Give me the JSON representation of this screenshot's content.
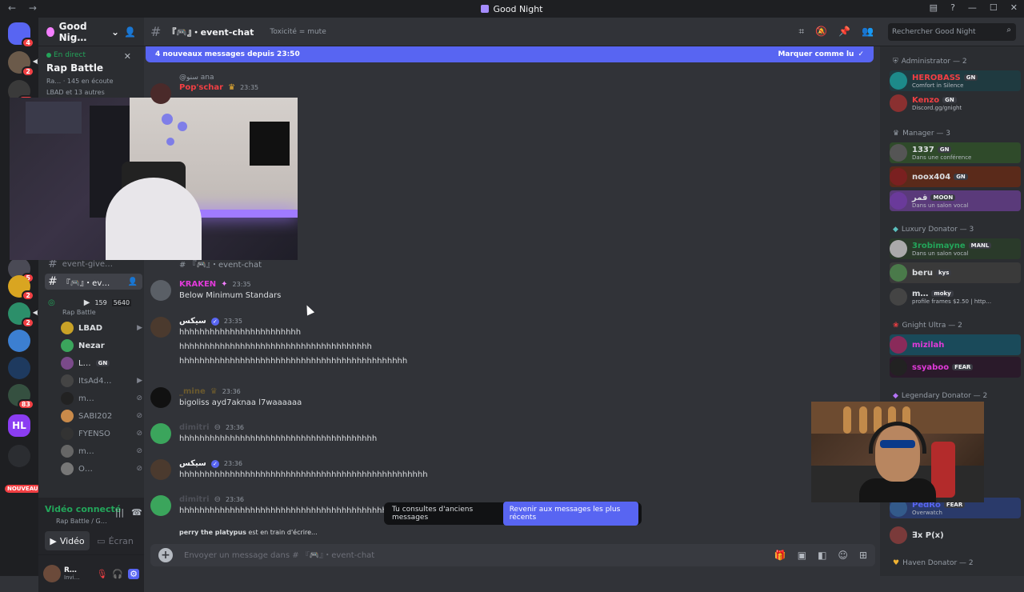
{
  "titlebar": {
    "title": "Good Night",
    "nav_arrows": "← →"
  },
  "server": {
    "name": "Good Nig…",
    "live_label": "En direct",
    "live_channel": "Rap Battle",
    "live_meta": "Ra… · 145 en écoute",
    "live_meta2": "LBAD et 13 autres"
  },
  "guild_badges": [
    "4",
    "2",
    "21",
    "5",
    "2",
    "2",
    "83"
  ],
  "guild_new": "NOUVEAU",
  "sidebar_channels": {
    "giveaway": "event-give…",
    "active": "『🎮』・ev…",
    "voice_name": "Rap Battle",
    "voice_counts": [
      "159",
      "5640"
    ]
  },
  "voice_users": [
    {
      "name": "LBAD",
      "color": "#dbdee1",
      "bold": true
    },
    {
      "name": "Nezar",
      "color": "#dbdee1",
      "bold": true
    },
    {
      "name": "L…",
      "color": "#dbdee1",
      "bold": false,
      "tag": "GN"
    },
    {
      "name": "ItsAd4…",
      "color": "#949ba4",
      "bold": false
    },
    {
      "name": "m…",
      "color": "#949ba4",
      "bold": false
    },
    {
      "name": "SABI202",
      "color": "#949ba4",
      "bold": false
    },
    {
      "name": "FYENSO",
      "color": "#949ba4",
      "bold": false
    },
    {
      "name": "m…",
      "color": "#949ba4",
      "bold": false
    },
    {
      "name": "O…",
      "color": "#949ba4",
      "bold": false
    }
  ],
  "voice_panel": {
    "status": "Vidéo connecté",
    "sub": "Rap Battle / G…",
    "video_label": "Vidéo",
    "screen_label": "Écran"
  },
  "user_panel": {
    "name": "R…",
    "status": "Invi…"
  },
  "chat": {
    "channel_name": "『🎮』・event-chat",
    "topic": "Toxicité = mute",
    "new_messages": "4 nouveaux messages depuis 23:50",
    "mark_read": "Marquer comme lu",
    "reply_ref": "@سنو ana",
    "channel_ref": "『🎮』・event-chat",
    "composer_placeholder": "Envoyer un message dans # 『🎮』・event-chat",
    "old_messages_text": "Tu consultes d'anciens messages",
    "jump_label": "Revenir aux messages les plus récents",
    "typing_user": "perry the platypus",
    "typing_text": "est en train d'écrire..."
  },
  "messages": [
    {
      "author": "Pop'schar",
      "color": "#f23f43",
      "time": "23:35",
      "lines": []
    },
    {
      "author": "KRAKEN",
      "color": "#e13ad9",
      "time": "23:35",
      "lines": [
        "Below Minimum Standars"
      ]
    },
    {
      "author": "سيكس",
      "color": "#f2f3f5",
      "time": "23:35",
      "verified": true,
      "lines": [
        "hhhhhhhhhhhhhhhhhhhhhhhh",
        "hhhhhhhhhhhhhhhhhhhhhhhhhhhhhhhhhhhhhh",
        "hhhhhhhhhhhhhhhhhhhhhhhhhhhhhhhhhhhhhhhhhhhhh"
      ]
    },
    {
      "author": "_mine",
      "color": "#6b5a2e",
      "time": "23:36",
      "lines": [
        "bigoliss ayd7aknaa l7waaaaaa"
      ]
    },
    {
      "author": "dimitri",
      "color": "#4e5058",
      "time": "23:36",
      "lines": [
        "hhhhhhhhhhhhhhhhhhhhhhhhhhhhhhhhhhhhhhh"
      ]
    },
    {
      "author": "سيكس",
      "color": "#f2f3f5",
      "time": "23:36",
      "verified": true,
      "lines": [
        "hhhhhhhhhhhhhhhhhhhhhhhhhhhhhhhhhhhhhhhhhhhhhhhhh"
      ]
    },
    {
      "author": "dimitri",
      "color": "#4e5058",
      "time": "23:36",
      "lines": [
        "hhhhhhhhhhhhhhhhhhhhhhhhhhhhhhhhhhhhhhhhhhhhhhhhhhhhh"
      ]
    }
  ],
  "search": {
    "placeholder": "Rechercher Good Night"
  },
  "members": {
    "roles": [
      {
        "label": "Administrator — 2"
      },
      {
        "label": "Manager — 3"
      },
      {
        "label": "Luxury Donator — 3"
      },
      {
        "label": "Gnight Ultra — 2"
      },
      {
        "label": "Legendary Donator — 2"
      },
      {
        "label": "Haven Donator — 2"
      }
    ],
    "list": [
      {
        "name": "HEROBASS",
        "color": "#f23f43",
        "tag": "GN",
        "status": "Comfort in Silence"
      },
      {
        "name": "Kenzo",
        "color": "#f23f43",
        "tag": "GN",
        "status": "Discord.gg/gnight"
      },
      {
        "name": "1337",
        "color": "#dbdee1",
        "tag": "GN",
        "status": "Dans une conférence"
      },
      {
        "name": "noox404",
        "color": "#dbdee1",
        "tag": "GN",
        "status": ""
      },
      {
        "name": "قمر",
        "color": "#dbdee1",
        "tag": "MOON",
        "status": "Dans un salon vocal"
      },
      {
        "name": "3robimayne",
        "color": "#23a55a",
        "tag": "MANL",
        "status": "Dans un salon vocal"
      },
      {
        "name": "beru",
        "color": "#dbdee1",
        "tag": "kys",
        "status": ""
      },
      {
        "name": "m…",
        "color": "#dbdee1",
        "tag": "moky",
        "status": "profile frames $2.50 | http…"
      },
      {
        "name": "mizilah",
        "color": "#e13ad9",
        "tag": "",
        "status": ""
      },
      {
        "name": "ssyaboo",
        "color": "#e13ad9",
        "tag": "FEAR",
        "status": ""
      },
      {
        "name": "PedRo",
        "color": "#5865f2",
        "tag": "FEAR",
        "status": "Overwatch"
      },
      {
        "name": "∃x P(x)",
        "color": "#dbdee1",
        "tag": "",
        "status": ""
      }
    ]
  },
  "icons": {
    "discord": "discord-icon",
    "search": "search-icon",
    "pin": "pin-icon",
    "members": "members-icon",
    "threads": "threads-icon",
    "mute": "mute-icon",
    "gift": "gift-icon",
    "gif": "gif-icon",
    "sticker": "sticker-icon",
    "emoji": "emoji-icon",
    "apps": "apps-icon",
    "gear": "gear-icon",
    "headset": "headset-icon",
    "mic": "mic-muted-icon"
  },
  "colors": {
    "accent": "#5865f2",
    "online": "#23a55a",
    "danger": "#f23f43",
    "bg": "#313338",
    "sidebar": "#2b2d31",
    "rail": "#1e1f22"
  }
}
